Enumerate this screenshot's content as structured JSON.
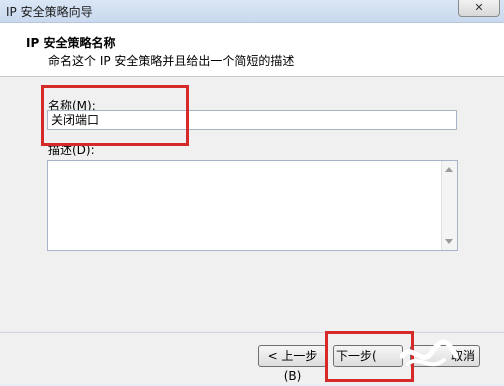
{
  "window": {
    "title": "IP 安全策略向导",
    "close_glyph": "✕"
  },
  "header": {
    "title": "IP 安全策略名称",
    "subtitle": "命名这个 IP 安全策略并且给出一个简短的描述"
  },
  "form": {
    "name_label": "名称(M):",
    "name_value": "关闭端口",
    "desc_label": "描述(D):",
    "desc_value": ""
  },
  "buttons": {
    "back": "< 上一步(B)",
    "next": "下一步(",
    "cancel": "取消"
  },
  "colors": {
    "highlight": "#d42a2a"
  }
}
